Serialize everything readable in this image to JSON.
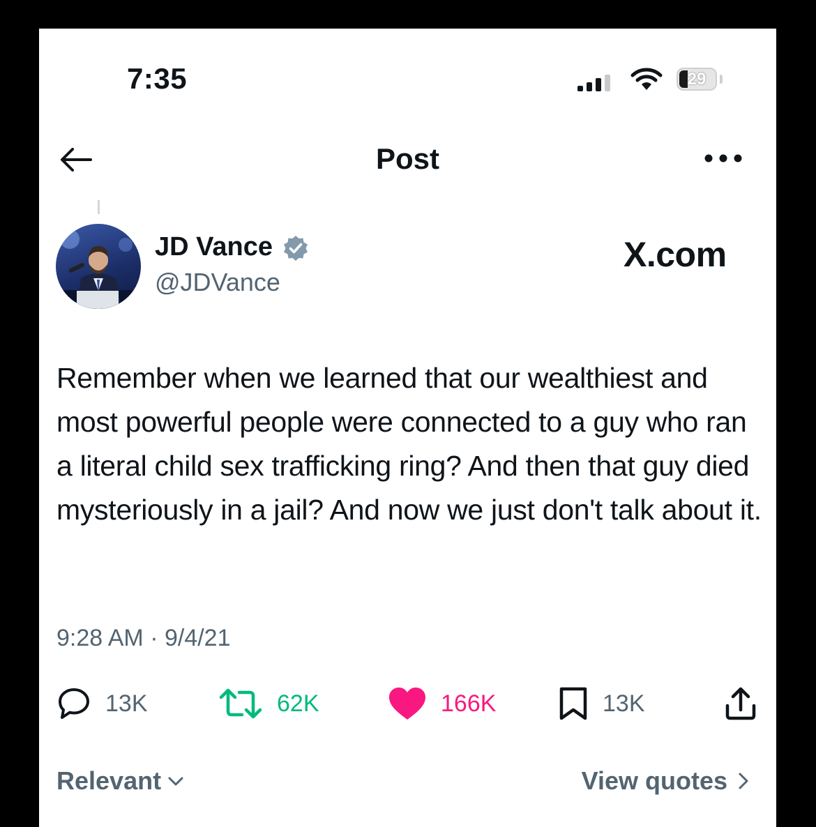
{
  "status_bar": {
    "time": "7:35",
    "battery": "29"
  },
  "nav": {
    "title": "Post"
  },
  "author": {
    "name": "JD Vance",
    "handle": "@JDVance",
    "verified": true
  },
  "watermark": "X.com",
  "post": {
    "text": "Remember when we learned that our wealthiest and most powerful people were connected to a guy who ran a literal child sex trafficking ring? And then that guy died mysteriously in a jail? And now we just don't talk about it.",
    "meta": "9:28 AM · 9/4/21"
  },
  "actions": {
    "replies": "13K",
    "reposts": "62K",
    "likes": "166K",
    "bookmarks": "13K"
  },
  "footer": {
    "sort_label": "Relevant",
    "quotes_label": "View quotes"
  },
  "colors": {
    "text": "#0f1419",
    "secondary": "#536471",
    "repost": "#00ba7c",
    "like": "#f91880",
    "verified": "#829aab"
  }
}
